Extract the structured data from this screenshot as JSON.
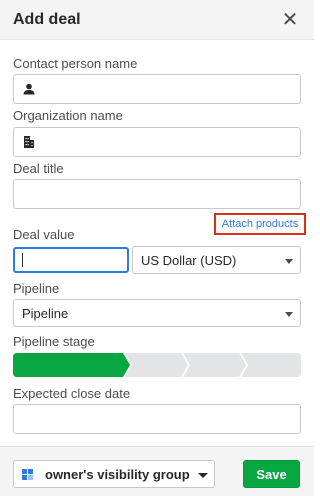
{
  "dialog": {
    "title": "Add deal",
    "close_symbol": "✕"
  },
  "fields": {
    "contact_person": {
      "label": "Contact person name",
      "value": ""
    },
    "organization": {
      "label": "Organization name",
      "value": ""
    },
    "deal_title": {
      "label": "Deal title",
      "value": ""
    },
    "attach_products": "Attach products",
    "deal_value": {
      "label": "Deal value",
      "value": "",
      "currency": "US Dollar (USD)"
    },
    "pipeline": {
      "label": "Pipeline",
      "value": "Pipeline"
    },
    "pipeline_stage": {
      "label": "Pipeline stage",
      "stage_count": 5,
      "active_stage": 1
    },
    "expected_close_date": {
      "label": "Expected close date",
      "value": ""
    }
  },
  "footer": {
    "visibility": "owner's visibility group",
    "save": "Save"
  },
  "colors": {
    "accent": "#317ae2",
    "save": "#08a742",
    "stage_active": "#08a742",
    "stage_inactive": "#e3e4e6",
    "highlight": "#d9301c"
  }
}
